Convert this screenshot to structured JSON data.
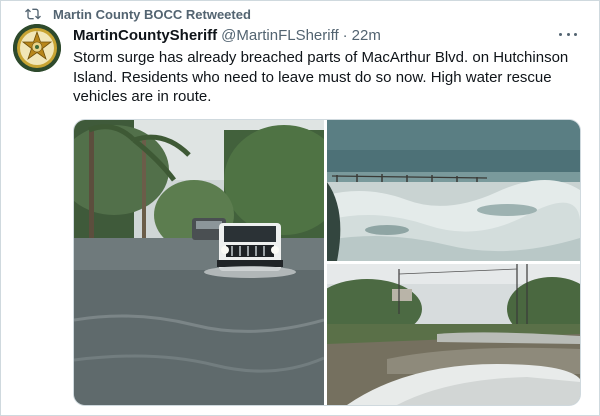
{
  "retweet": {
    "label": "Martin County BOCC Retweeted",
    "icon": "retweet-icon"
  },
  "tweet": {
    "author_name": "MartinCountySheriff",
    "handle": "@MartinFLSheriff",
    "separator": "·",
    "time": "22m",
    "text": "Storm surge has already breached parts of MacArthur Blvd. on Hutchinson Island. Residents who need to leave must do so now. High water rescue vehicles are in route.",
    "avatar_icon": "sheriff-star-badge-icon"
  },
  "media": {
    "photos": [
      {
        "subject": "jeep-driving-through-flooded-street"
      },
      {
        "subject": "storm-surge-waves-over-beach"
      },
      {
        "subject": "flooded-road-seen-from-vehicle"
      }
    ]
  },
  "colors": {
    "text_primary": "#0f1419",
    "text_secondary": "#536471",
    "border": "#cfd9de"
  }
}
